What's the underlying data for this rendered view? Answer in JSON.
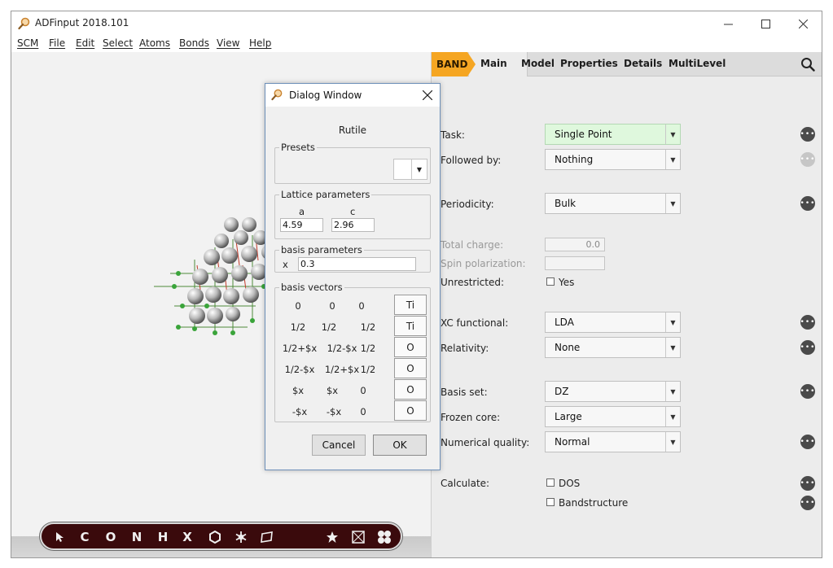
{
  "window": {
    "title": "ADFinput 2018.101",
    "minimize_icon": "minimize-icon",
    "maximize_icon": "maximize-icon",
    "close_icon": "close-icon"
  },
  "menu": [
    "SCM",
    "File",
    "Edit",
    "Select",
    "Atoms",
    "Bonds",
    "View",
    "Help"
  ],
  "tabs": {
    "band": "BAND",
    "items": [
      "Main",
      "Model",
      "Properties",
      "Details",
      "MultiLevel"
    ]
  },
  "form": {
    "task_label": "Task:",
    "task_value": "Single Point",
    "followed_label": "Followed by:",
    "followed_value": "Nothing",
    "periodicity_label": "Periodicity:",
    "periodicity_value": "Bulk",
    "charge_label": "Total charge:",
    "charge_value": "0.0",
    "spin_label": "Spin polarization:",
    "spin_value": "",
    "unrestricted_label": "Unrestricted:",
    "unrestricted_check": "Yes",
    "xc_label": "XC functional:",
    "xc_value": "LDA",
    "relativity_label": "Relativity:",
    "relativity_value": "None",
    "basis_label": "Basis set:",
    "basis_value": "DZ",
    "frozen_label": "Frozen core:",
    "frozen_value": "Large",
    "numq_label": "Numerical quality:",
    "numq_value": "Normal",
    "calc_label": "Calculate:",
    "dos_check": "DOS",
    "band_check": "Bandstructure"
  },
  "dialog": {
    "title": "Dialog Window",
    "heading": "Rutile",
    "presets_label": "Presets",
    "lattice_label": "Lattice parameters",
    "a_label": "a",
    "a_value": "4.59",
    "c_label": "c",
    "c_value": "2.96",
    "basis_params_label": "basis parameters",
    "x_label": "x",
    "x_value": "0.3",
    "basis_vectors_label": "basis vectors",
    "vectors": [
      {
        "v1": "0",
        "v2": "0",
        "v3": "0",
        "atom": "Ti"
      },
      {
        "v1": "1/2",
        "v2": "1/2",
        "v3": "1/2",
        "atom": "Ti"
      },
      {
        "v1": "1/2+$x",
        "v2": "1/2-$x",
        "v3": "1/2",
        "atom": "O"
      },
      {
        "v1": "1/2-$x",
        "v2": "1/2+$x",
        "v3": "1/2",
        "atom": "O"
      },
      {
        "v1": "$x",
        "v2": "$x",
        "v3": "0",
        "atom": "O"
      },
      {
        "v1": "-$x",
        "v2": "-$x",
        "v3": "0",
        "atom": "O"
      }
    ],
    "cancel": "Cancel",
    "ok": "OK"
  },
  "toolbar": {
    "tools": [
      "C",
      "O",
      "N",
      "H",
      "X"
    ]
  },
  "colors": {
    "band_tab": "#f5a623",
    "task_highlight": "#dff8dd",
    "toolbar_bg": "#3a0a0c",
    "atom_green": "#3aa43a"
  }
}
